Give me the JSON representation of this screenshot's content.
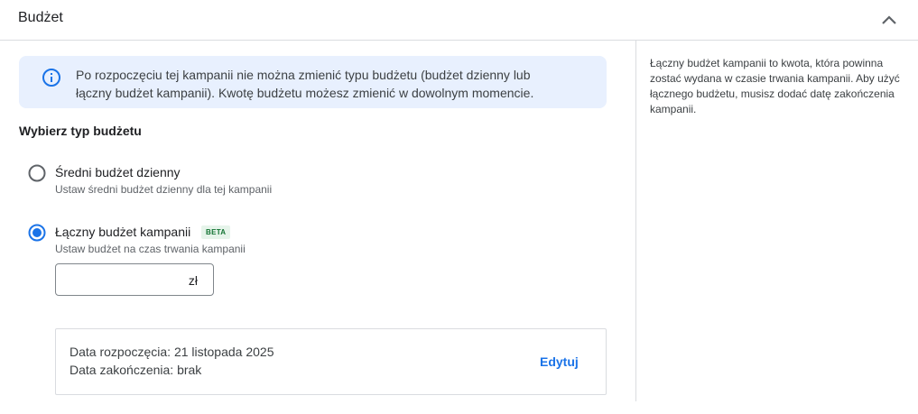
{
  "header": {
    "title": "Budżet",
    "collapse_icon": "chevron-up-icon"
  },
  "info": {
    "icon": "info-icon",
    "text_line1": "Po rozpoczęciu tej kampanii nie można zmienić typu budżetu (budżet dzienny lub",
    "text_line2": "łączny budżet kampanii). Kwotę budżetu możesz zmienić w dowolnym momencie."
  },
  "budget_type": {
    "label": "Wybierz typ budżetu",
    "options": [
      {
        "label": "Średni budżet dzienny",
        "description": "Ustaw średni budżet dzienny dla tej kampanii",
        "selected": false
      },
      {
        "label": "Łączny budżet kampanii",
        "badge": "BETA",
        "description": "Ustaw budżet na czas trwania kampanii",
        "selected": true
      }
    ]
  },
  "amount": {
    "value": "",
    "currency_suffix": "zł"
  },
  "dates": {
    "start": "Data rozpoczęcia: 21 listopada 2025",
    "end": "Data zakończenia: brak",
    "edit_label": "Edytuj"
  },
  "side_help": {
    "text": "Łączny budżet kampanii to kwota, która powinna zostać wydana w czasie trwania kampanii. Aby użyć łącznego budżetu, musisz dodać datę zakończenia kampanii."
  },
  "colors": {
    "accent": "#1a73e8",
    "info_bg": "#e8f0fe",
    "beta_bg": "#e6f4ea",
    "beta_text": "#137333"
  }
}
